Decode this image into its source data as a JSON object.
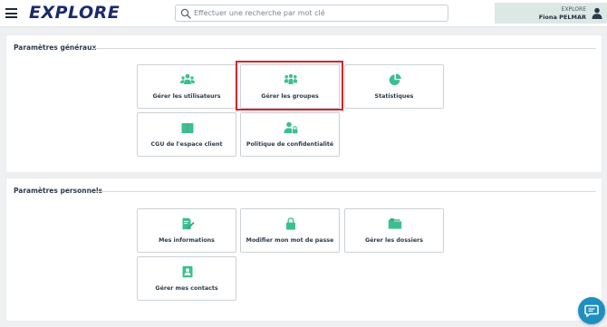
{
  "header": {
    "logo": "EXPLORE",
    "search": {
      "placeholder": "Effectuer une recherche par mot clé",
      "value": ""
    },
    "account": {
      "org": "EXPLORE",
      "user": "Fiona PELMAR"
    }
  },
  "sections": {
    "general": {
      "title": "Paramètres généraux",
      "cards": [
        {
          "label": "Gérer les utilisateurs",
          "icon": "users-icon"
        },
        {
          "label": "Gérer les groupes",
          "icon": "groups-icon",
          "highlighted": true
        },
        {
          "label": "Statistiques",
          "icon": "pie-chart-icon"
        },
        {
          "label": "CGU de l'espace client",
          "icon": "book-icon"
        },
        {
          "label": "Politique de confidentialité",
          "icon": "user-lock-icon"
        }
      ]
    },
    "personal": {
      "title": "Paramètres personnels",
      "cards": [
        {
          "label": "Mes informations",
          "icon": "edit-document-icon"
        },
        {
          "label": "Modifier mon mot de passe",
          "icon": "lock-icon"
        },
        {
          "label": "Gérer les dossiers",
          "icon": "folder-icon"
        },
        {
          "label": "Gérer mes contacts",
          "icon": "contact-card-icon"
        }
      ]
    }
  },
  "colors": {
    "accent": "#3cbf8f",
    "brand": "#1a2a6c",
    "highlight": "#d9222b",
    "chat": "#1f8fc0"
  }
}
